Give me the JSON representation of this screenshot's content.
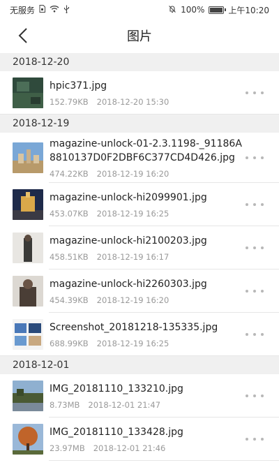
{
  "status": {
    "carrier": "无服务",
    "battery": "100%",
    "battery_level": 1.0,
    "time": "上午10:20"
  },
  "header": {
    "title": "图片"
  },
  "sections": [
    {
      "date": "2018-12-20",
      "items": [
        {
          "name": "hpic371.jpg",
          "size": "152.79KB",
          "time": "2018-12-20 15:30"
        }
      ]
    },
    {
      "date": "2018-12-19",
      "items": [
        {
          "name": "magazine-unlock-01-2.3.1198-_91186A8810137D0F2DBF6C377CD4D426.jpg",
          "size": "474.22KB",
          "time": "2018-12-19 16:20"
        },
        {
          "name": "magazine-unlock-hi2099901.jpg",
          "size": "453.07KB",
          "time": "2018-12-19 16:25"
        },
        {
          "name": "magazine-unlock-hi2100203.jpg",
          "size": "458.51KB",
          "time": "2018-12-19 16:17"
        },
        {
          "name": "magazine-unlock-hi2260303.jpg",
          "size": "454.39KB",
          "time": "2018-12-19 16:20"
        },
        {
          "name": "Screenshot_20181218-135335.jpg",
          "size": "688.99KB",
          "time": "2018-12-19 16:25"
        }
      ]
    },
    {
      "date": "2018-12-01",
      "items": [
        {
          "name": "IMG_20181110_133210.jpg",
          "size": "8.73MB",
          "time": "2018-12-01 21:47"
        },
        {
          "name": "IMG_20181110_133428.jpg",
          "size": "23.97MB",
          "time": "2018-12-01 21:46"
        }
      ]
    }
  ]
}
